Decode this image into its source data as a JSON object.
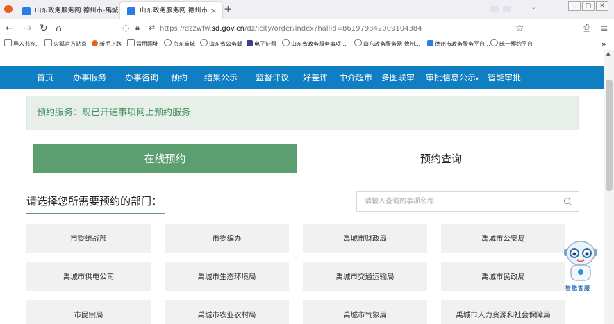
{
  "browser": {
    "tabs": [
      {
        "title": "山东政务服务网 德州市-禹城市",
        "close": "×"
      },
      {
        "title": "山东政务服务网 德州市",
        "close": "×"
      }
    ],
    "new_tab": "+",
    "url_prefix": "https://dzzwfw.",
    "url_domain": "sd.gov.cn",
    "url_suffix": "/dz/icity/order/index?hallId=861979842009104384",
    "bookmarks": [
      "导入书签...",
      "火狐官方站点",
      "新手上路",
      "常用网址",
      "京东商城",
      "山东省公务邮",
      "电子证照",
      "山东省政务服务事项...",
      "山东政务服务网 德州...",
      "德州市政务服务平台...",
      "统一预约平台"
    ],
    "bookmark_overflow": "»"
  },
  "nav": [
    "首页",
    "办事服务",
    "办事咨询",
    "预约",
    "结果公示",
    "监督评议",
    "好差评",
    "中介超市",
    "多图联审",
    "审批信息公示",
    "智能审批"
  ],
  "nav_dropdown_mark": "▾",
  "notice": "预约服务：现已开通事项网上预约服务",
  "tabs": {
    "online": "在线预约",
    "query": "预约查询"
  },
  "dept_title": "请选择您所需要预约的部门：",
  "search_placeholder": "请输入查询的事项名称",
  "departments": [
    "市委统战部",
    "市委编办",
    "禹城市财政局",
    "禹城市公安局",
    "禹城市供电公司",
    "禹城市生态环境局",
    "禹城市交通运输局",
    "禹城市民政局",
    "市民宗局",
    "禹城市农业农村局",
    "禹城市气象局",
    "禹城市人力资源和社会保障局"
  ],
  "assistant_label": "智能客服",
  "colors": {
    "nav_blue": "#0f7ec2",
    "green": "#5b9f70",
    "notice_bg": "#e8efe8"
  }
}
